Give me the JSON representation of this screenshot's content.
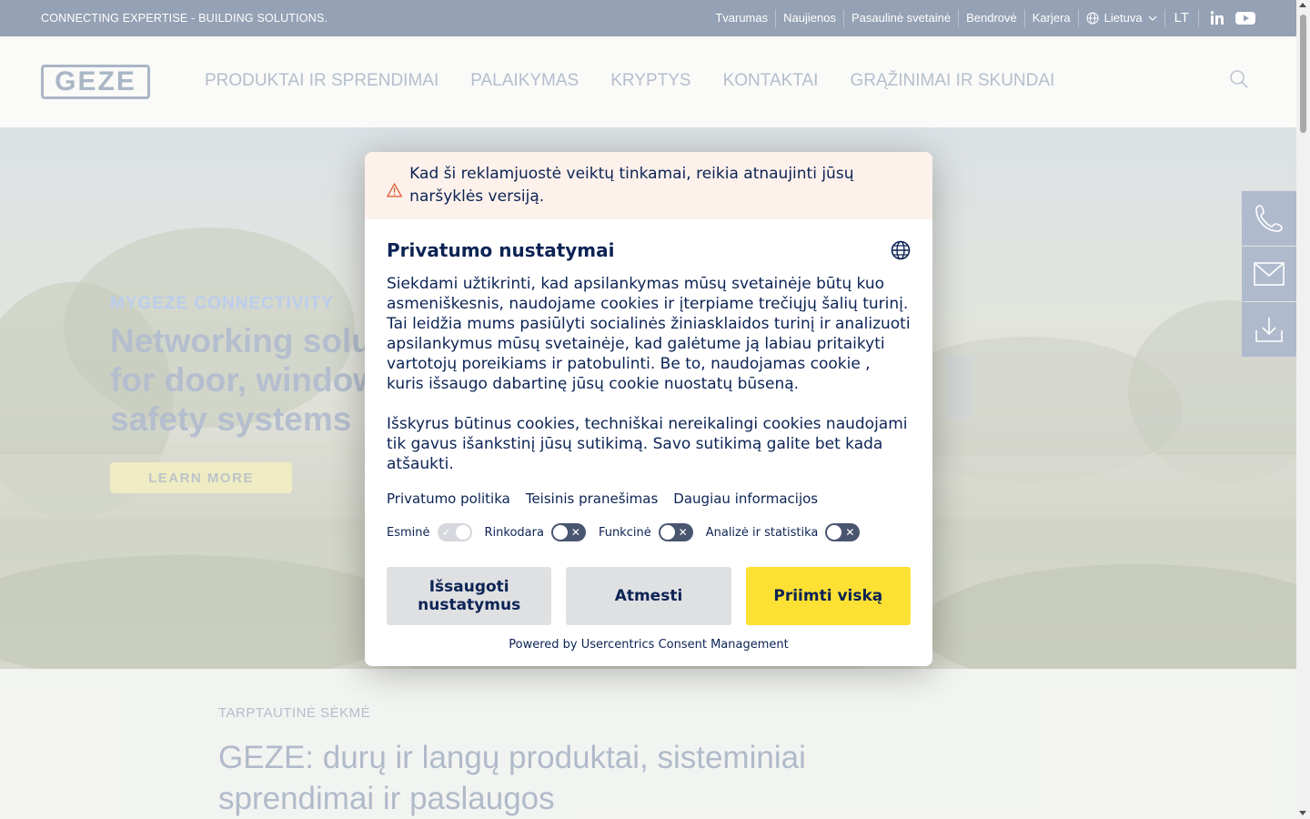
{
  "topbar": {
    "tagline": "CONNECTING EXPERTISE - BUILDING SOLUTIONS.",
    "links": [
      "Tvarumas",
      "Naujienos",
      "Pasaulinė svetainė",
      "Bendrovė",
      "Karjera"
    ],
    "country": "Lietuva",
    "language": "LT",
    "social": [
      "linkedin-icon",
      "youtube-icon"
    ]
  },
  "header": {
    "logo": "GEZE",
    "nav": [
      "PRODUKTAI IR SPRENDIMAI",
      "PALAIKYMAS",
      "KRYPTYS",
      "KONTAKTAI",
      "GRĄŽINIMAI IR SKUNDAI"
    ]
  },
  "hero": {
    "kicker": "MYGEZE CONNECTIVITY",
    "title_lines": [
      "Networking solu",
      "for door, window",
      "safety systems"
    ],
    "button": "LEARN MORE"
  },
  "side_dock": [
    "phone-icon",
    "mail-icon",
    "download-icon"
  ],
  "content": {
    "kicker": "TARPTAUTINĖ SĖKMĖ",
    "heading": "GEZE: durų ir langų produktai, sisteminiai sprendimai ir paslaugos"
  },
  "consent": {
    "warning": "Kad ši reklamjuostė veiktų tinkamai, reikia atnaujinti jūsų naršyklės versiją.",
    "title": "Privatumo nustatymai",
    "paragraph1": "Siekdami užtikrinti, kad apsilankymas mūsų svetainėje būtų kuo asmeniškesnis, naudojame cookies ir įterpiame trečiųjų šalių turinį. Tai leidžia mums pasiūlyti socialinės žiniasklaidos turinį ir analizuoti apsilankymus mūsų svetainėje, kad galėtume ją labiau pritaikyti vartotojų poreikiams ir patobulinti. Be to, naudojamas cookie , kuris išsaugo dabartinę jūsų cookie nuostatų būseną.",
    "paragraph2": "Išskyrus būtinus cookies, techniškai nereikalingi cookies naudojami tik gavus išankstinį jūsų sutikimą. Savo sutikimą galite bet kada atšaukti.",
    "links": [
      "Privatumo politika",
      "Teisinis pranešimas",
      "Daugiau informacijos"
    ],
    "toggles": [
      {
        "label": "Esminė",
        "state": "on-disabled"
      },
      {
        "label": "Rinkodara",
        "state": "off"
      },
      {
        "label": "Funkcinė",
        "state": "off"
      },
      {
        "label": "Analizė ir statistika",
        "state": "off"
      }
    ],
    "buttons": {
      "save": "Išsaugoti nustatymus",
      "reject": "Atmesti",
      "accept": "Priimti viską"
    },
    "powered_by": "Powered by Usercentrics Consent Management"
  },
  "colors": {
    "accent_yellow": "#fce033",
    "navy_text": "#0c2354",
    "topbar": "#5c6f8c",
    "warning_bg": "#fdf1eb"
  }
}
